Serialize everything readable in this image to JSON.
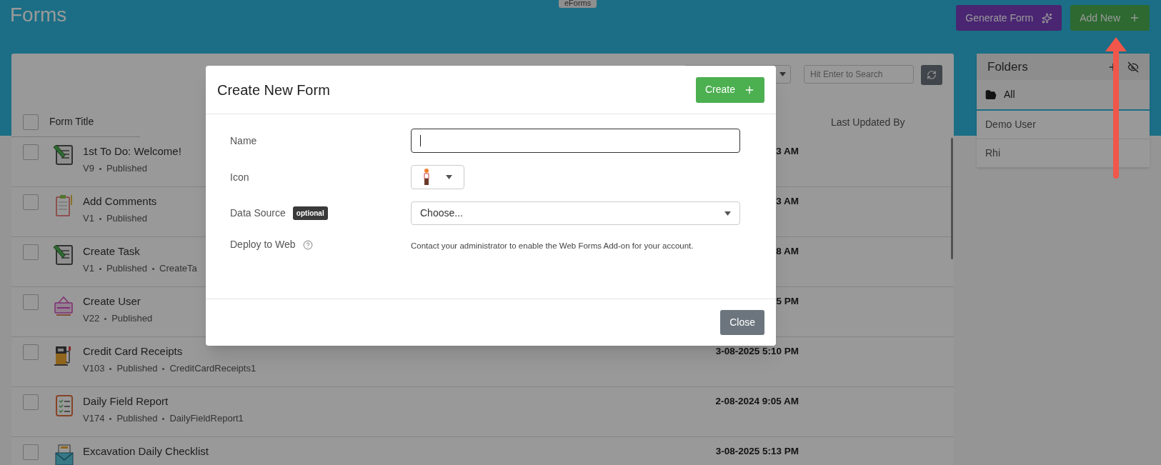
{
  "page_title": "Forms",
  "top_tab": "eForms",
  "header_buttons": [
    {
      "label": "Generate Form",
      "kind": "generate"
    },
    {
      "label": "Add New",
      "kind": "add"
    }
  ],
  "list": {
    "search": {
      "placeholder": "Hit Enter to Search"
    },
    "select_all_checked": false,
    "columns": [
      "Form Title",
      "Last Updated By"
    ],
    "rows": [
      {
        "title": "1st To Do: Welcome!",
        "meta": [
          "V9",
          "Published"
        ],
        "updated": "3 AM",
        "kind": "pencil-note",
        "checked": false
      },
      {
        "title": "Add Comments",
        "meta": [
          "V1",
          "Published"
        ],
        "updated": "3 AM",
        "kind": "clipboard",
        "checked": false
      },
      {
        "title": "Create Task",
        "meta": [
          "V1",
          "Published",
          "CreateTa"
        ],
        "updated": "8 AM",
        "kind": "pencil-note",
        "checked": false
      },
      {
        "title": "Create User",
        "meta": [
          "V22",
          "Published"
        ],
        "updated": "5 PM",
        "kind": "hiring-sign",
        "checked": false
      },
      {
        "title": "Credit Card Receipts",
        "meta": [
          "V103",
          "Published",
          "CreditCardReceipts1"
        ],
        "updated": "3-08-2025 5:10 PM",
        "kind": "fuel-pump",
        "checked": false
      },
      {
        "title": "Daily Field Report",
        "meta": [
          "V174",
          "Published",
          "DailyFieldReport1"
        ],
        "updated": "2-08-2024 9:05 AM",
        "kind": "checklist",
        "checked": false
      },
      {
        "title": "Excavation Daily Checklist",
        "updated": "3-08-2025 5:13 PM",
        "kind": "envelope",
        "checked": false
      }
    ]
  },
  "folders": {
    "title": "Folders",
    "items": [
      {
        "label": "All",
        "selected": true
      },
      {
        "label": "Demo User",
        "selected": false
      },
      {
        "label": "Rhi",
        "selected": false
      }
    ]
  },
  "modal": {
    "title": "Create New Form",
    "create_button": "Create",
    "close_button": "Close",
    "fields": [
      {
        "kind": "text",
        "label": "Name"
      },
      {
        "kind": "icon-select",
        "label": "Icon"
      },
      {
        "kind": "select",
        "label": "Data Source",
        "badge": "optional",
        "value": "Choose..."
      },
      {
        "kind": "note",
        "label": "Deploy to Web",
        "note": "Contact your administrator to enable the Web Forms Add-on for your account."
      }
    ]
  }
}
